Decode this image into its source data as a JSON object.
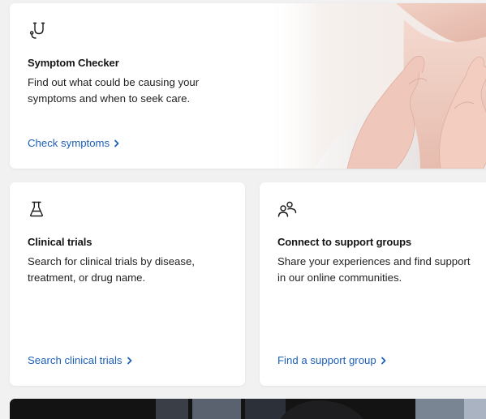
{
  "symptom_card": {
    "title": "Symptom Checker",
    "description": "Find out what could be causing your symptoms and when to seek care.",
    "link": "Check symptoms",
    "icon": "stethoscope-icon"
  },
  "clinical_card": {
    "title": "Clinical trials",
    "description": "Search for clinical trials by disease, treatment, or drug name.",
    "link": "Search clinical trials",
    "icon": "flask-icon"
  },
  "support_card": {
    "title": "Connect to support groups",
    "description": "Share your experiences and find support in our online communities.",
    "link": "Find a support group",
    "icon": "people-icon"
  },
  "colors": {
    "link": "#1d5fb8",
    "background": "#f1f1f2",
    "card": "#ffffff"
  }
}
